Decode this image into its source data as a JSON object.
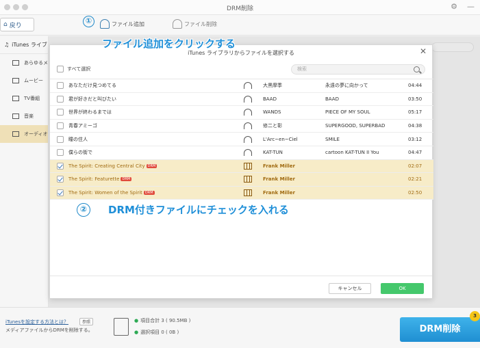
{
  "window": {
    "title": "DRM削除"
  },
  "toolbar": {
    "back_label": "戻り",
    "add_file_label": "ファイル追加",
    "remove_file_label": "ファイル削除"
  },
  "annotations": {
    "step1_number": "①",
    "step1_text": "ファイル追加をクリックする",
    "step2_number": "②",
    "step2_text": "DRM付きファイルにチェックを入れる"
  },
  "sidebar": {
    "header": "iTunes ライブラ",
    "items": [
      {
        "label": "あらゆるメデ",
        "icon": "music-note-icon"
      },
      {
        "label": "ムービー",
        "icon": "film-icon"
      },
      {
        "label": "TV番組",
        "icon": "tv-icon"
      },
      {
        "label": "音楽",
        "icon": "speaker-icon"
      },
      {
        "label": "オーディオブ",
        "icon": "audiobook-icon",
        "active": true
      }
    ]
  },
  "dialog": {
    "title": "iTunes ライブラリからファイルを選択する",
    "select_all_label": "すべて選択",
    "search_placeholder": "検索",
    "drm_badge": "DRM",
    "rows": [
      {
        "checked": false,
        "drm": false,
        "kind": "headphones-icon",
        "title": "あなただけ見つめてる",
        "artist": "大黒摩季",
        "album": "永遠の夢に向かって",
        "time": "04:44"
      },
      {
        "checked": false,
        "drm": false,
        "kind": "headphones-icon",
        "title": "君が好きだと叫びたい",
        "artist": "BAAD",
        "album": "BAAD",
        "time": "03:50"
      },
      {
        "checked": false,
        "drm": false,
        "kind": "headphones-icon",
        "title": "世界が終わるまでは",
        "artist": "WANDS",
        "album": "PIECE OF MY SOUL",
        "time": "05:17"
      },
      {
        "checked": false,
        "drm": false,
        "kind": "headphones-icon",
        "title": "青春アミーゴ",
        "artist": "修二と彰",
        "album": "SUPERGOOD, SUPERBAD",
        "time": "04:38"
      },
      {
        "checked": false,
        "drm": false,
        "kind": "headphones-icon",
        "title": "瞳の住人",
        "artist": "L'Arc~en~Ciel",
        "album": "SMILE",
        "time": "03:12"
      },
      {
        "checked": false,
        "drm": false,
        "kind": "headphones-icon",
        "title": "僕らの街で",
        "artist": "KAT-TUN",
        "album": "cartoon KAT-TUN II You",
        "time": "04:47"
      },
      {
        "checked": true,
        "drm": true,
        "kind": "film-icon",
        "title": "The Spirit: Creating Central City",
        "artist": "Frank Miller",
        "album": "",
        "time": "02:07"
      },
      {
        "checked": true,
        "drm": true,
        "kind": "film-icon",
        "title": "The Spirit: Featurette",
        "artist": "Frank Miller",
        "album": "",
        "time": "02:21"
      },
      {
        "checked": true,
        "drm": true,
        "kind": "film-icon",
        "title": "The Spirit: Women of the Spirit",
        "artist": "Frank Miller",
        "album": "",
        "time": "02:50"
      }
    ],
    "cancel_label": "キャンセル",
    "ok_label": "OK"
  },
  "bottom": {
    "help_link": "iTunesを設定する方法とは？",
    "help_button": "参照",
    "help_sub": "メディアファイルからDRMを削除する。",
    "total_label": "項目合計 3 ( 90.5MB )",
    "selected_label": "選択項目 0 ( 0B )",
    "drm_button": "DRM削除",
    "drm_count": "3"
  },
  "colors": {
    "accent_blue": "#1f8fd8",
    "ok_green": "#45c86c",
    "drm_row": "#f7ecc8",
    "drm_badge": "#e04a3b"
  }
}
